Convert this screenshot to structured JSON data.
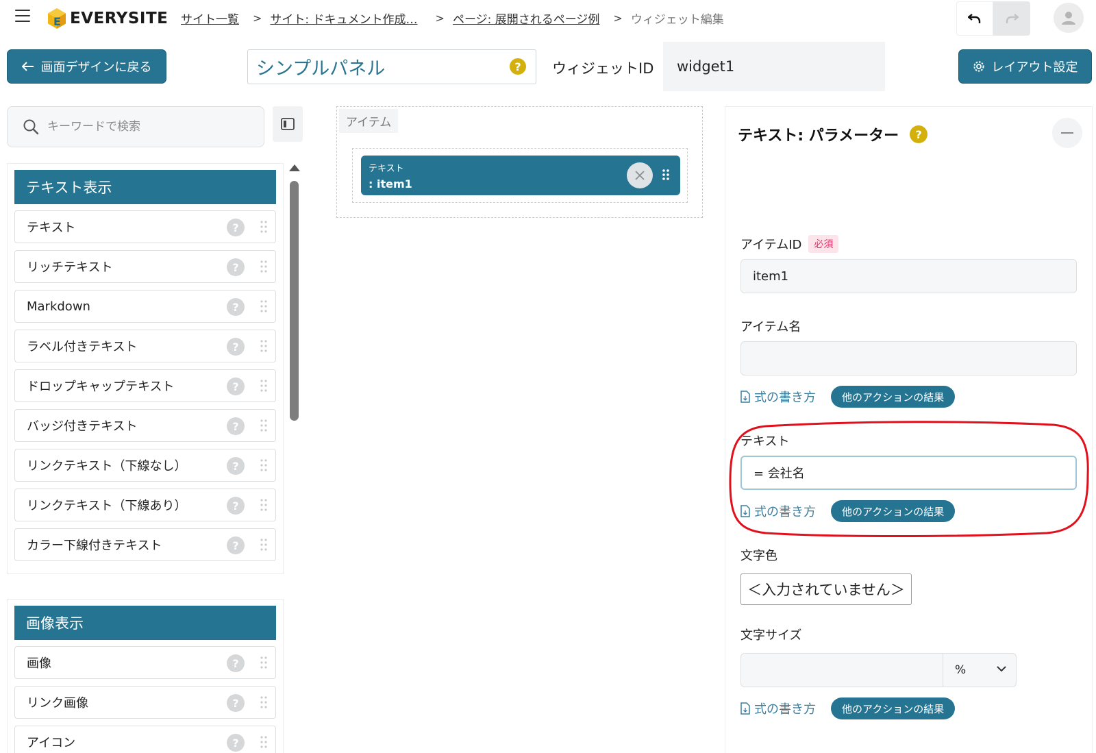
{
  "header": {
    "logo_text": "EVERYSITE",
    "breadcrumb": [
      {
        "label": "サイト一覧",
        "link": true
      },
      {
        "label": "サイト: ドキュメント作成…",
        "link": true
      },
      {
        "label": "ページ: 展開されるページ例",
        "link": true
      },
      {
        "label": "ウィジェット編集",
        "link": false
      }
    ],
    "breadcrumb_separator": ">"
  },
  "toolbar": {
    "back_label": "画面デザインに戻る",
    "widget_title": "シンプルパネル",
    "widget_id_label": "ウィジェットID",
    "widget_id_value": "widget1",
    "layout_label": "レイアウト設定"
  },
  "sidebar": {
    "search_placeholder": "キーワードで検索",
    "groups": [
      {
        "title": "テキスト表示",
        "items": [
          "テキスト",
          "リッチテキスト",
          "Markdown",
          "ラベル付きテキスト",
          "ドロップキャップテキスト",
          "バッジ付きテキスト",
          "リンクテキスト（下線なし）",
          "リンクテキスト（下線あり）",
          "カラー下線付きテキスト"
        ]
      },
      {
        "title": "画像表示",
        "items": [
          "画像",
          "リンク画像",
          "アイコン"
        ]
      }
    ]
  },
  "canvas": {
    "label": "アイテム",
    "chip_type": "テキスト",
    "chip_id": ": item1"
  },
  "properties": {
    "title": "テキスト: パラメーター",
    "item_id_label": "アイテムID",
    "required_badge": "必須",
    "item_id_value": "item1",
    "item_name_label": "アイテム名",
    "item_name_value": "",
    "formula_link": "式の書き方",
    "action_pill": "他のアクションの結果",
    "text_label": "テキスト",
    "text_value": "= 会社名",
    "color_label": "文字色",
    "color_value": "＜入力されていません＞",
    "size_label": "文字サイズ",
    "size_value": "",
    "size_unit": "%"
  },
  "colors": {
    "primary": "#257592",
    "help_yellow": "#d4b00c",
    "link_blue": "#3a7ea0",
    "required_pink": "#e0356b",
    "annotation_red": "#e0101c"
  },
  "icons": {
    "help": "?",
    "remove": "close-icon",
    "back": "arrow-left-icon",
    "layout": "gear-icon"
  }
}
